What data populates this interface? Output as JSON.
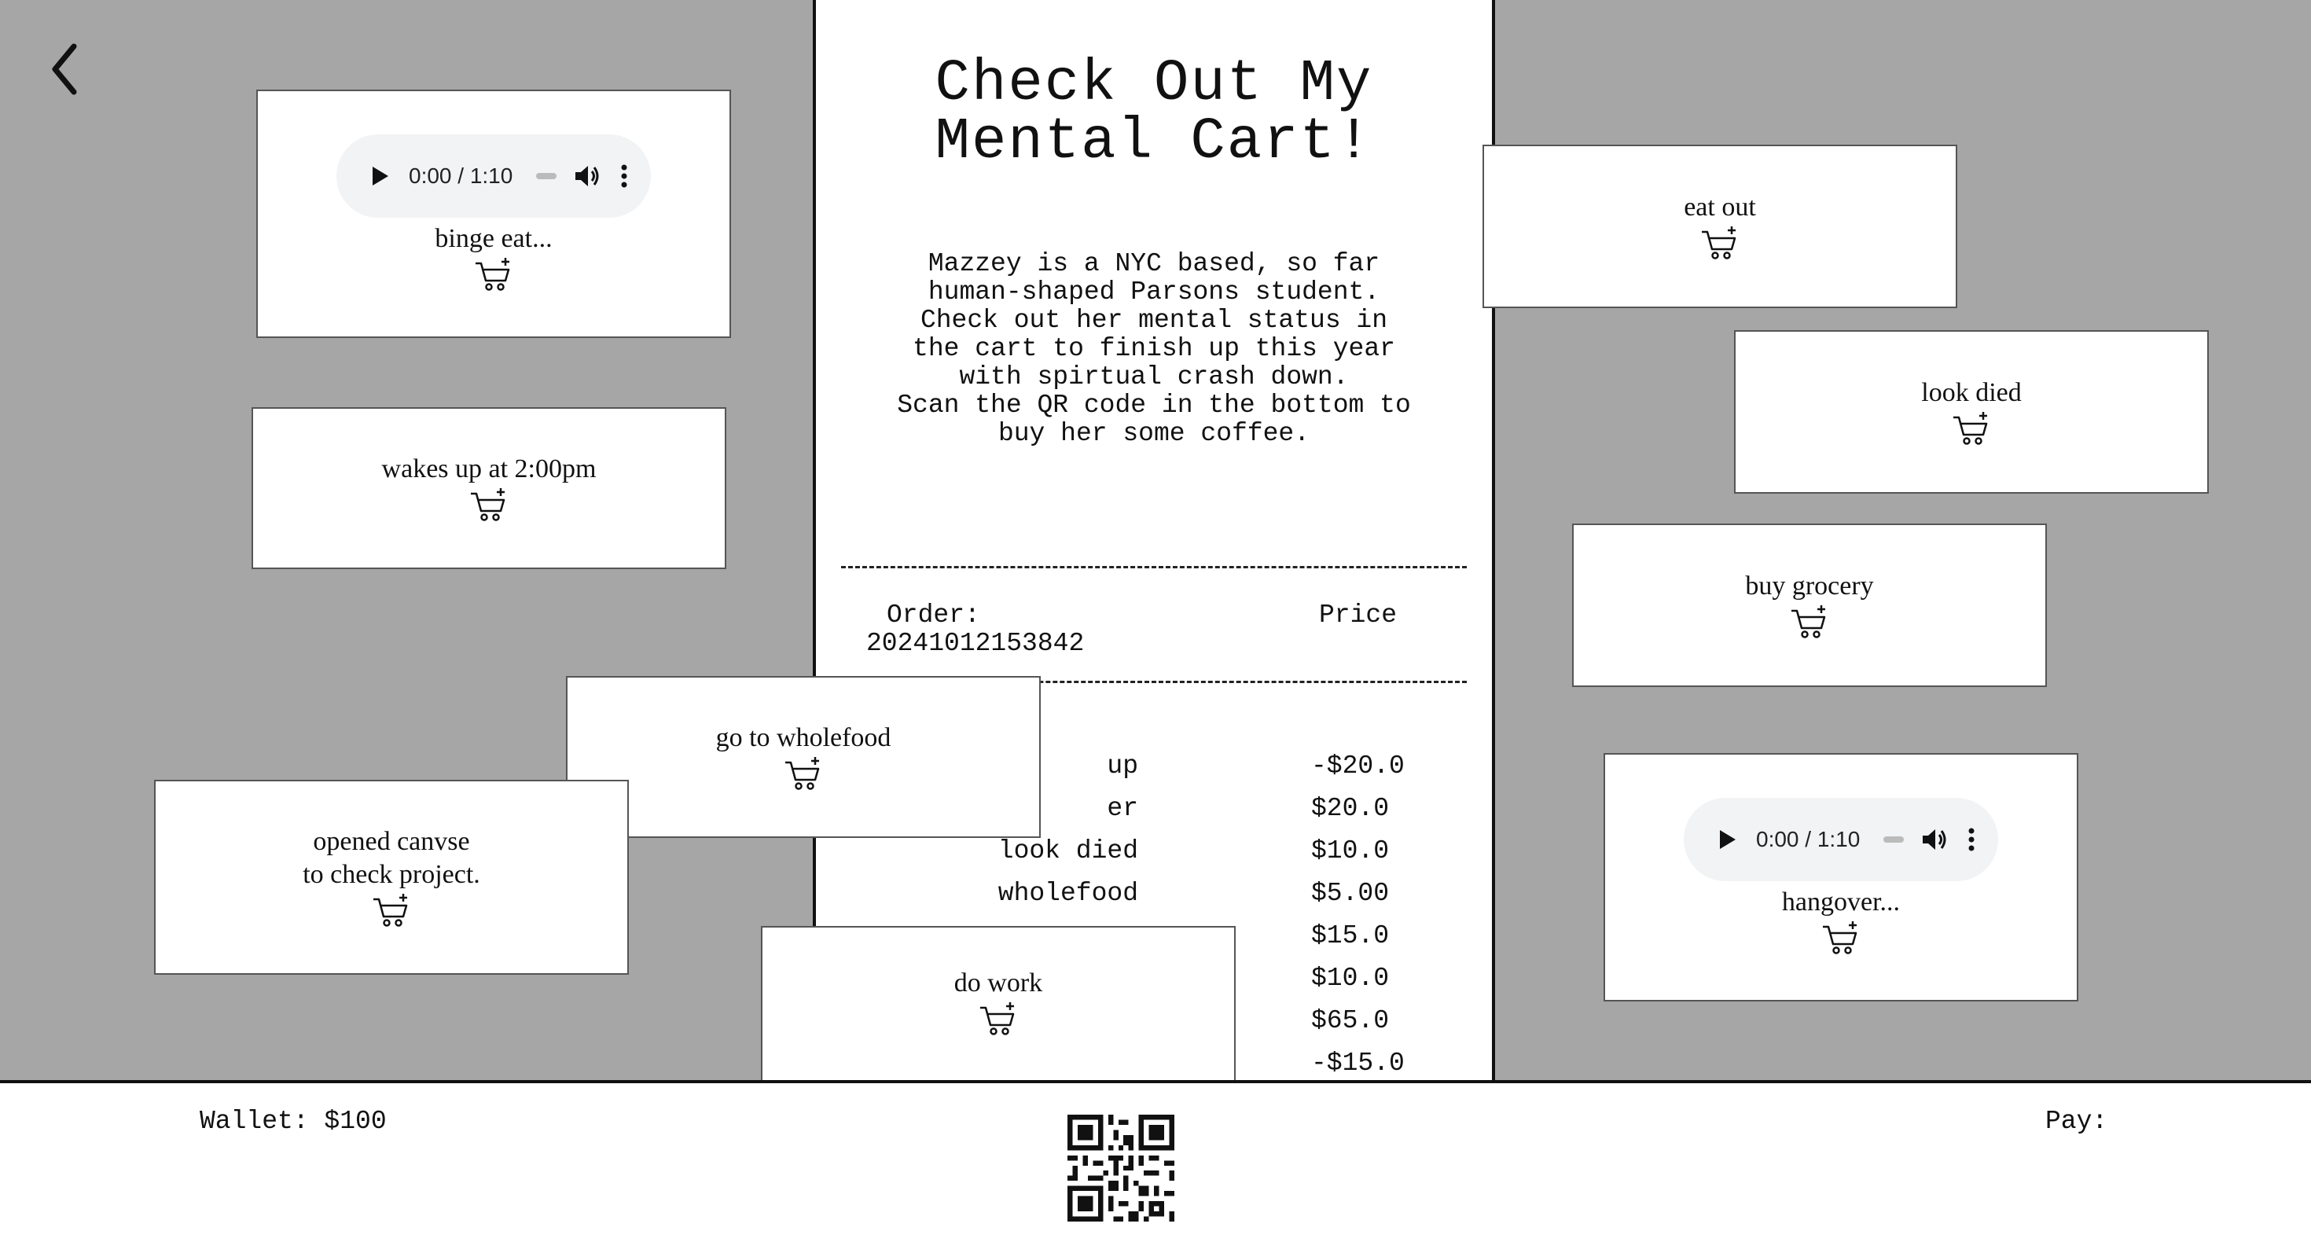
{
  "nav": {
    "back_icon": "chevron-left-icon"
  },
  "receipt": {
    "title_line1": "Check Out My",
    "title_line2": "Mental Cart!",
    "description": [
      "Mazzey is a NYC based, so far human-shaped Parsons student. Check out her mental status in the cart to finish up this year with spirtual crash down.",
      "Scan the QR code in the bottom to buy her some coffee."
    ],
    "order_label": "Order:",
    "order_number": "20241012153842",
    "price_label": "Price",
    "items": [
      {
        "name": "up",
        "price": "-$20.0"
      },
      {
        "name": "er",
        "price": "$20.0"
      },
      {
        "name": "look died",
        "price": "$10.0"
      },
      {
        "name": "wholefood",
        "price": "$5.00"
      },
      {
        "name": "",
        "price": "$15.0"
      },
      {
        "name": "",
        "price": "$10.0"
      },
      {
        "name": "",
        "price": "$65.0"
      },
      {
        "name": "",
        "price": "-$15.0"
      }
    ]
  },
  "cards": {
    "binge": {
      "label": "binge eat...",
      "audio_time": "0:00 / 1:10"
    },
    "wakes": {
      "label": "wakes up at 2:00pm"
    },
    "canvas": {
      "label": "opened canvse\nto check project."
    },
    "wholefood": {
      "label": "go to wholefood"
    },
    "work": {
      "label": "do work"
    },
    "eat_out": {
      "label": "eat out"
    },
    "look_died": {
      "label": "look died"
    },
    "grocery": {
      "label": "buy grocery"
    },
    "hangover": {
      "label": "hangover...",
      "audio_time": "0:00 / 1:10"
    }
  },
  "footer": {
    "wallet": "Wallet: $100",
    "pay": "Pay:",
    "qr_icon": "qr-code-icon"
  }
}
